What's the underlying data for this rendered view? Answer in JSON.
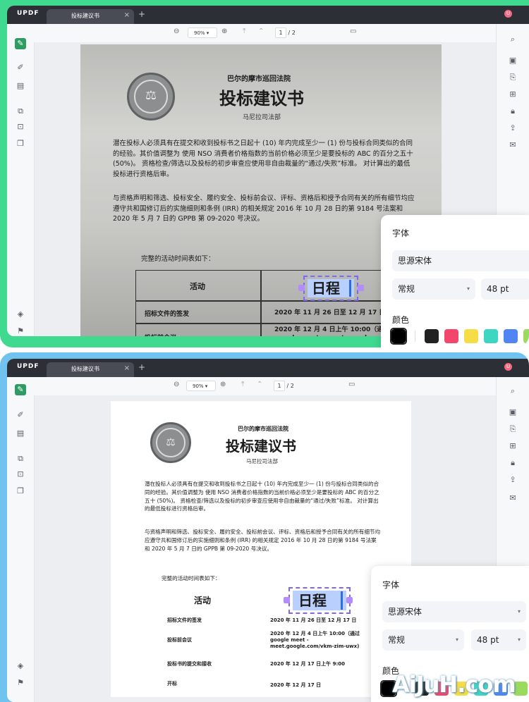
{
  "app": {
    "logo": "UPDF",
    "tab_title": "投标建议书",
    "tab_close": "×",
    "tab_add": "+",
    "avatar": "U"
  },
  "toolbar": {
    "zoom_out": "⊖",
    "zoom": "90%",
    "zoom_caret": "▾",
    "zoom_in": "⊕",
    "first_page": "⤒",
    "prev_page": "⌃",
    "current_page": "1",
    "page_sep": "/",
    "total_pages": "2",
    "comment": "▭"
  },
  "document": {
    "court": "巴尔的摩市巡回法院",
    "title": "投标建议书",
    "department": "马尼拉司法部",
    "para1": "潜在投标人必须具有在提交和收到投标书之日起十 (10) 年内完成至少一 (1) 份与投标合同类似的合同的经验。其价值调整为 使用 NSO 消费者价格指数的当前价格必须至少是要投标的 ABC 的百分之五十 (50%)。 资格检查/筛选以及投标的初步审查应使用非自由裁量的“通过/失败”标准。 对计算出的最低投标进行资格后审。",
    "para2": "与资格声明和筛选、投标安全、履约安全、投标前会议、评标、资格后和授予合同有关的所有细节均应遵守共和国修订后的实施细则和条例 (IRR) 的相关规定 2016 年 10 月 28 日的第 9184 号法案和 2020 年 5 月 7 日的 GPPB 第 09-2020 号决议。",
    "timeline_intro": "完整的活动时间表如下：",
    "col_activity": "活动",
    "col_schedule": "日程",
    "rows": [
      {
        "activity": "招标文件的签发",
        "date": "2020 年 11 月 26 日至 12 月 17 日"
      },
      {
        "activity": "投标前会议",
        "date": "2020 年 12 月 4 日上午 10:00（通过 google meet - meet.google.com/vkm-zim-uwx)"
      },
      {
        "activity": "投标书的提交和接收",
        "date": "2020 年 12 月 17 日上午 9:00"
      },
      {
        "activity": "开标",
        "date": "2020 年 12 月 17 日"
      }
    ],
    "row2_short": "2020 年 12 月 4 日上午 10:00（通过 google meet - meet.google.com/"
  },
  "panel": {
    "font_label": "字体",
    "font_value": "思源宋体",
    "style_value": "常规",
    "size_value": "48 pt",
    "color_label": "颜色",
    "caret": "▾"
  },
  "colors": {
    "accent_green": "#3fd98f",
    "accent_blue": "#6fc3ee",
    "selection": "#b9d0ff",
    "handle": "#b48cff"
  },
  "swatches": [
    "#000000",
    "#222222",
    "#f2466a",
    "#f7dd45",
    "#3dd6c0",
    "#4f86f3",
    "#9adb5e"
  ],
  "watermark": "AiJuH.com"
}
